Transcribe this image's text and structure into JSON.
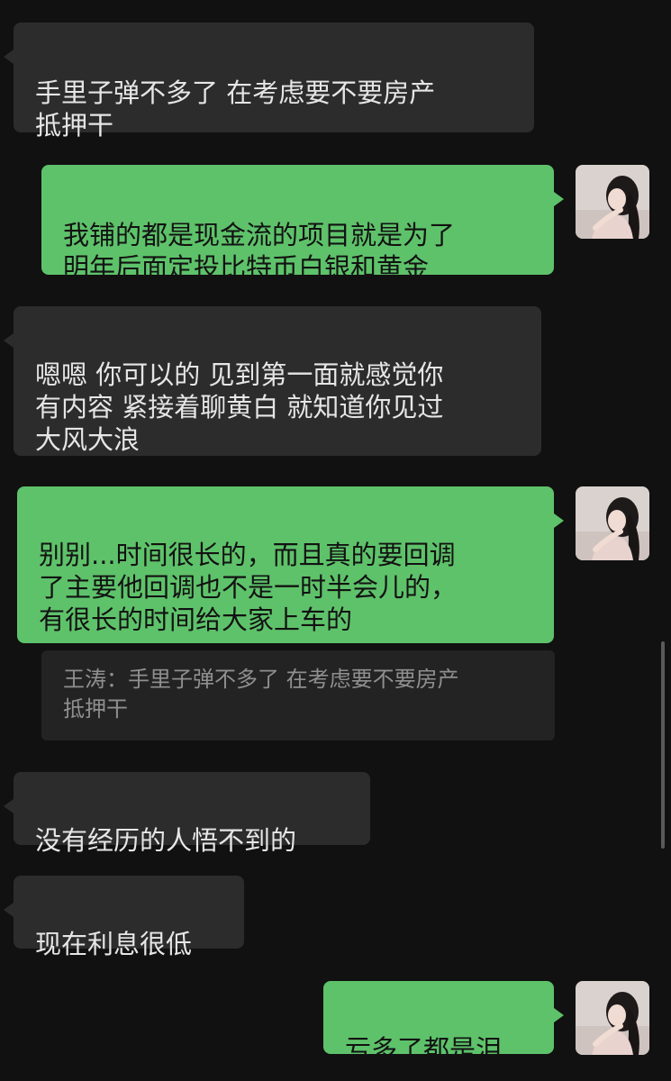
{
  "chat": {
    "messages": [
      {
        "sender": "other",
        "text": "手里子弹不多了 在考虑要不要房产\n抵押干"
      },
      {
        "sender": "me",
        "text": "我铺的都是现金流的项目就是为了\n明年后面定投比特币白银和黄金"
      },
      {
        "sender": "other",
        "text": "嗯嗯 你可以的 见到第一面就感觉你\n有内容 紧接着聊黄白 就知道你见过\n大风大浪"
      },
      {
        "sender": "me",
        "text": "别别...时间很长的，而且真的要回调\n了主要他回调也不是一时半会儿的，\n有很长的时间给大家上车的",
        "quote": {
          "author": "王涛",
          "text": "手里子弹不多了 在考虑要不要房产\n抵押干"
        }
      },
      {
        "sender": "other",
        "text": "没有经历的人悟不到的"
      },
      {
        "sender": "other",
        "text": "现在利息很低"
      },
      {
        "sender": "me",
        "text": "亏多了都是泪"
      }
    ]
  },
  "theme": {
    "background": "#111111",
    "incoming_bubble": "#2c2c2c",
    "outgoing_bubble": "#5ec26a",
    "quote_background": "#232323"
  },
  "icons": {
    "avatar": "user-avatar-photo"
  }
}
